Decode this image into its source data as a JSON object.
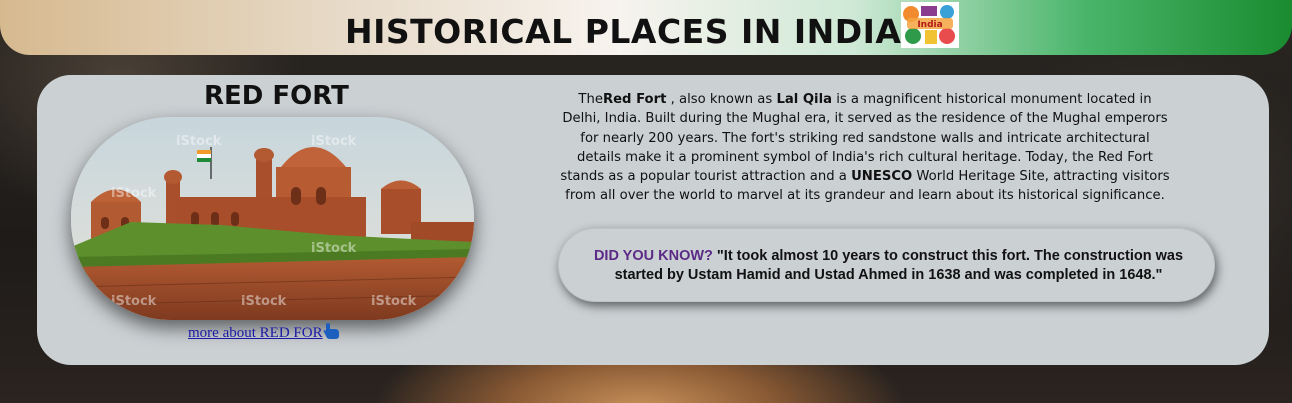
{
  "header": {
    "title": "HISTORICAL PLACES IN INDIA",
    "logo_icon": "india-collage-icon",
    "logo_text": "India",
    "gradient_colors": [
      "#d6b98f",
      "#f7f3ee",
      "#1a8b2f"
    ]
  },
  "card": {
    "title": "RED FORT",
    "link_text": "more about RED FOR",
    "link_icon": "pointing-hand-icon",
    "image_watermark": "iStock",
    "description": {
      "p1": "The",
      "b1": "Red Fort",
      "p2": " , also known as ",
      "b2": "Lal Qila",
      "p3": " is a magnificent historical monument located in Delhi, India. Built during the Mughal era, it served as the residence of the Mughal emperors for nearly 200 years. The fort's striking red sandstone walls and intricate architectural details make it a prominent symbol of India's rich cultural heritage. Today, the Red Fort stands as a popular tourist attraction and a ",
      "b3": "UNESCO",
      "p4": " World Heritage Site, attracting visitors from all over the world to marvel at its grandeur and learn about its historical significance."
    },
    "fact": {
      "label": "DID YOU KNOW?",
      "text": " \"It took almost 10 years to construct this fort. The construction was started by Ustam Hamid and Ustad Ahmed in 1638 and was completed in 1648.\""
    }
  }
}
